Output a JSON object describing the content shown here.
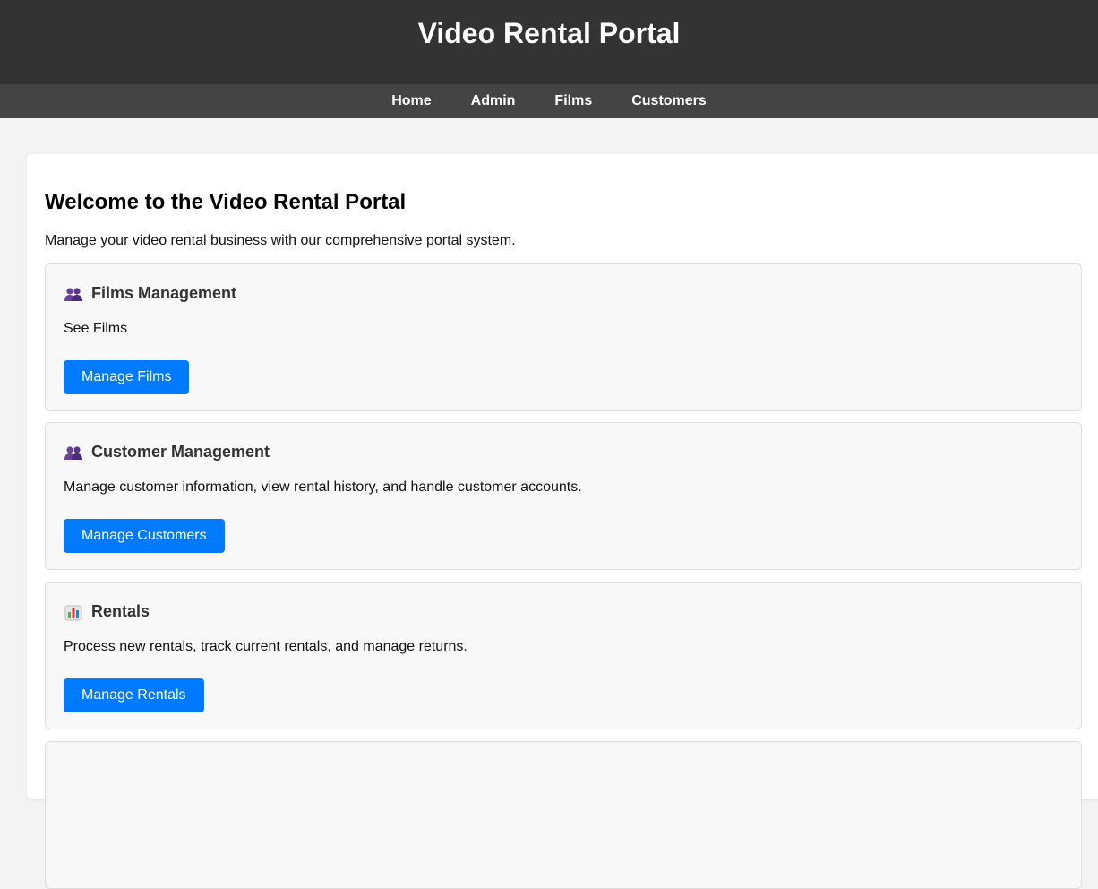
{
  "header": {
    "title": "Video Rental Portal"
  },
  "nav": {
    "items": [
      {
        "label": "Home"
      },
      {
        "label": "Admin"
      },
      {
        "label": "Films"
      },
      {
        "label": "Customers"
      }
    ]
  },
  "main": {
    "heading": "Welcome to the Video Rental Portal",
    "intro": "Manage your video rental business with our comprehensive portal system.",
    "cards": [
      {
        "icon": "users-icon",
        "title": "Films Management",
        "description": "See Films",
        "button_label": "Manage Films"
      },
      {
        "icon": "users-icon",
        "title": "Customer Management",
        "description": "Manage customer information, view rental history, and handle customer accounts.",
        "button_label": "Manage Customers"
      },
      {
        "icon": "bar-chart-icon",
        "title": "Rentals",
        "description": "Process new rentals, track current rentals, and manage returns.",
        "button_label": "Manage Rentals"
      }
    ]
  },
  "colors": {
    "header_bg": "#333333",
    "nav_bg": "#444444",
    "page_bg": "#f3f3f3",
    "card_bg": "#f8f8f8",
    "button_bg": "#007bff"
  }
}
